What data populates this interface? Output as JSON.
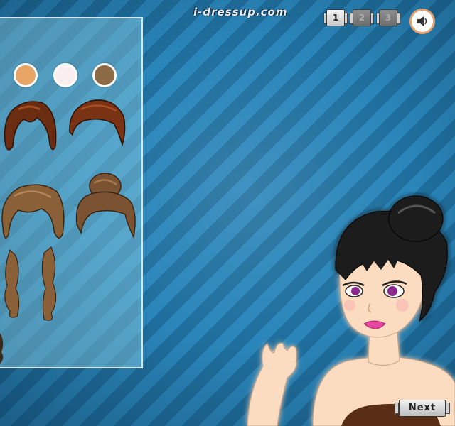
{
  "header": {
    "logo_text": "i-dressup.com",
    "pages": [
      {
        "label": "1",
        "active": true
      },
      {
        "label": "2",
        "active": false
      },
      {
        "label": "3",
        "active": false
      }
    ],
    "sound_icon": "speaker-icon"
  },
  "panel": {
    "skin_tones": [
      "#e8a565",
      "#fbeeee",
      "#8c6a45"
    ],
    "hair_options": [
      {
        "name": "short-auburn",
        "color": "#6b2d12"
      },
      {
        "name": "slick-back-brown",
        "color": "#7a3214"
      },
      {
        "name": "wavy-bob-light",
        "color": "#8a6038"
      },
      {
        "name": "top-bun-brown",
        "color": "#7b5332"
      },
      {
        "name": "long-curly-light",
        "color": "#8a6038"
      }
    ]
  },
  "model": {
    "hair_color": "#1c1c1c",
    "skin_color": "#fcdcc0",
    "eye_color": "#8b2a8e",
    "lip_color": "#e7479e",
    "top_color": "#5a2e14"
  },
  "footer": {
    "next_label": "Next"
  }
}
